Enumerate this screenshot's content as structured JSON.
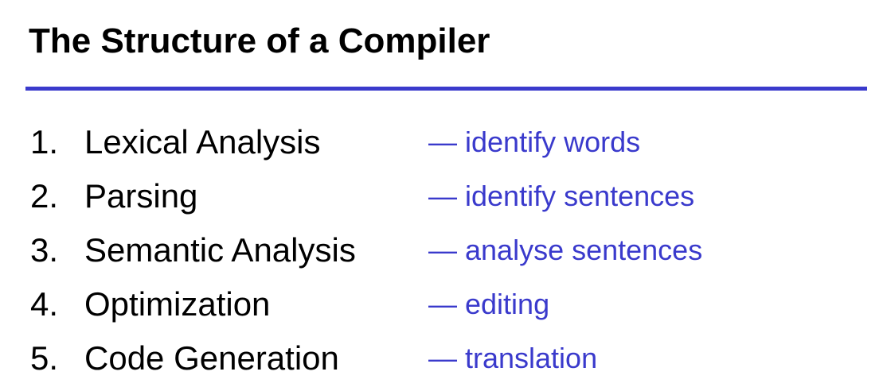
{
  "slide": {
    "title": "The Structure of a Compiler",
    "accent_color": "#3a3acc",
    "items": [
      {
        "number": "1.",
        "label": "Lexical Analysis",
        "description": "— identify words"
      },
      {
        "number": "2.",
        "label": "Parsing",
        "description": "— identify sentences"
      },
      {
        "number": "3.",
        "label": "Semantic Analysis",
        "description": "— analyse sentences"
      },
      {
        "number": "4.",
        "label": "Optimization",
        "description": "— editing"
      },
      {
        "number": "5.",
        "label": "Code Generation",
        "description": "— translation"
      }
    ]
  }
}
